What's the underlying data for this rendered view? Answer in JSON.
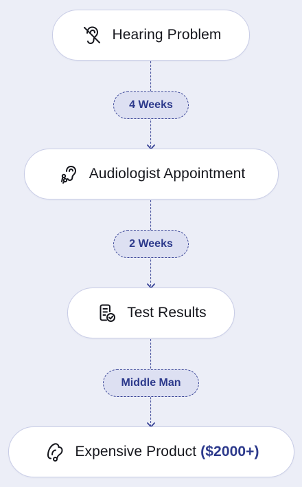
{
  "nodes": [
    {
      "label": "Hearing Problem",
      "icon": "ear-off-icon"
    },
    {
      "label": "Audiologist Appointment",
      "icon": "ear-hearing-icon"
    },
    {
      "label": "Test Results",
      "icon": "document-check-icon"
    },
    {
      "label": "Expensive Product",
      "highlight": "($2000+)",
      "icon": "hearing-aid-icon"
    }
  ],
  "connectors": [
    {
      "label": "4 Weeks"
    },
    {
      "label": "2 Weeks"
    },
    {
      "label": "Middle Man"
    }
  ],
  "colors": {
    "background": "#eceef7",
    "node_fill": "#ffffff",
    "node_border": "#c8cce6",
    "accent": "#2d3a8c",
    "pill_fill": "#dde0f2",
    "text": "#15161c"
  }
}
